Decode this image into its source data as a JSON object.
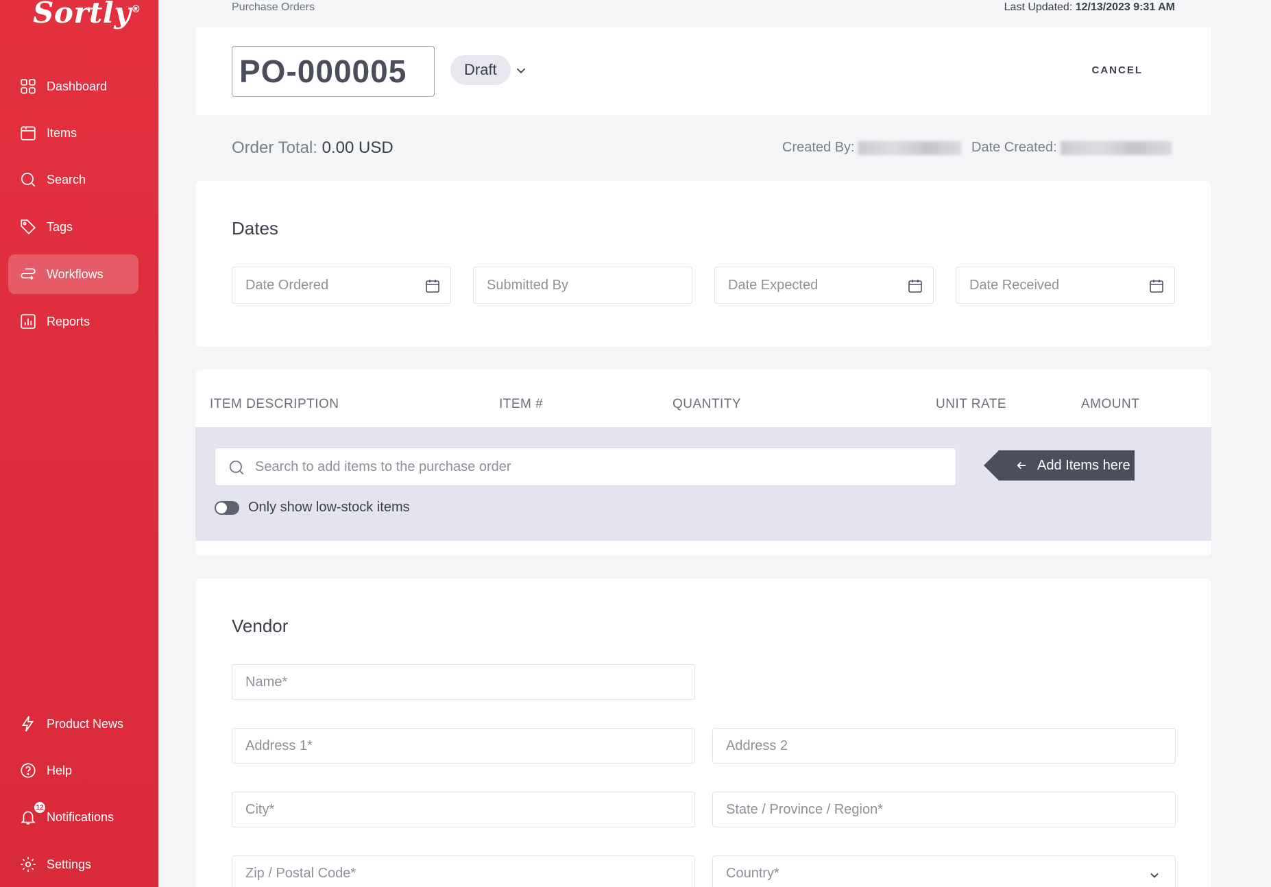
{
  "brand": {
    "logo": "Sortly",
    "mark": "®",
    "accent": "#e2303f"
  },
  "sidebar": {
    "items": [
      {
        "label": "Dashboard",
        "icon": "dashboard-icon"
      },
      {
        "label": "Items",
        "icon": "items-icon"
      },
      {
        "label": "Search",
        "icon": "search-icon"
      },
      {
        "label": "Tags",
        "icon": "tag-icon"
      },
      {
        "label": "Workflows",
        "icon": "workflows-icon",
        "active": true
      },
      {
        "label": "Reports",
        "icon": "reports-icon"
      }
    ],
    "bottom": [
      {
        "label": "Product News",
        "icon": "lightning-icon"
      },
      {
        "label": "Help",
        "icon": "help-icon"
      },
      {
        "label": "Notifications",
        "icon": "bell-icon",
        "badge": "12"
      },
      {
        "label": "Settings",
        "icon": "gear-icon"
      }
    ]
  },
  "header": {
    "breadcrumb": "Purchase Orders",
    "last_updated_label": "Last Updated:",
    "last_updated_value": "12/13/2023 9:31 AM",
    "po_number": "PO-000005",
    "status": "Draft",
    "cancel_label": "CANCEL"
  },
  "summary": {
    "order_total_label": "Order Total:",
    "order_total_value": "0.00 USD",
    "created_by_label": "Created By:",
    "date_created_label": "Date Created:"
  },
  "dates": {
    "title": "Dates",
    "date_ordered": "Date Ordered",
    "submitted_by": "Submitted By",
    "date_expected": "Date Expected",
    "date_received": "Date Received"
  },
  "items_table": {
    "columns": [
      "ITEM DESCRIPTION",
      "ITEM #",
      "QUANTITY",
      "UNIT RATE",
      "AMOUNT"
    ],
    "search_placeholder": "Search to add items to the purchase order",
    "add_hint": "Add Items here",
    "low_stock_label": "Only show low-stock items"
  },
  "vendor": {
    "title": "Vendor",
    "name": "Name*",
    "address1": "Address 1*",
    "address2": "Address 2",
    "city": "City*",
    "state": "State / Province / Region*",
    "zip": "Zip / Postal Code*",
    "country": "Country*"
  }
}
